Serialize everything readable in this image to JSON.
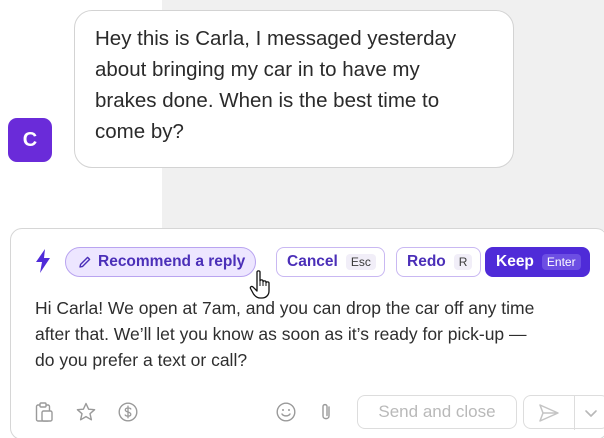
{
  "chat": {
    "avatar_initial": "C",
    "message_lines": [
      "Hey this is Carla, I messaged yesterday",
      "about bringing my car in to have my",
      "brakes done. When is the best time to",
      "come by?"
    ]
  },
  "composer": {
    "recommend_label": "Recommend a reply",
    "cancel_label": "Cancel",
    "cancel_key": "Esc",
    "redo_label": "Redo",
    "redo_key": "R",
    "keep_label": "Keep",
    "keep_key": "Enter",
    "draft_lines": [
      "Hi Carla! We open at 7am, and you can drop the car off any time",
      "after that. We’ll let you know as soon as it’s ready for pick-up —",
      "do you prefer a text or call?"
    ],
    "send_close_label": "Send and close"
  },
  "colors": {
    "accent": "#4f2bd8",
    "avatar": "#6a2bd9",
    "panel_gray": "#f0f0f0"
  },
  "icons": {
    "bolt": "lightning-icon",
    "pencil": "pencil-icon",
    "clipboard": "clipboard-icon",
    "star": "star-icon",
    "dollar": "dollar-icon",
    "emoji": "emoji-icon",
    "attach": "paperclip-icon",
    "send": "send-icon",
    "chevron": "chevron-down-icon"
  }
}
